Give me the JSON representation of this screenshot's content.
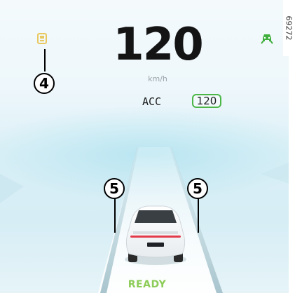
{
  "speed": {
    "value": "120",
    "unit": "km/h"
  },
  "acc": {
    "label": "ACC",
    "set_speed": "120",
    "active_color": "#4cb648"
  },
  "status": {
    "text": "READY",
    "color": "#8ccc58"
  },
  "icons": {
    "left_indicator": "vehicle-warning-icon",
    "right_indicator": "driver-assist-icon",
    "right_indicator_color": "#3fae3c",
    "left_indicator_color": "#e8c860"
  },
  "callouts": [
    {
      "label": "4"
    },
    {
      "label": "5"
    },
    {
      "label": "5"
    }
  ],
  "reference_code": "69272"
}
